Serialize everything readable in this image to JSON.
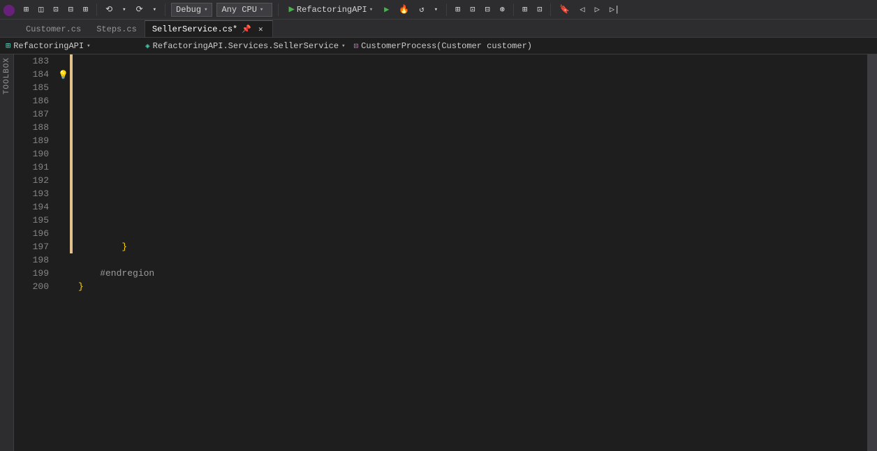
{
  "toolbar": {
    "undo_label": "⟲",
    "redo_label": "⟳",
    "debug_label": "Debug",
    "config_label": "Any CPU",
    "project_label": "RefactoringAPI",
    "run_label": "▶",
    "fire_icon": "🔥",
    "refresh_label": "↺",
    "separator": "|"
  },
  "tabs": [
    {
      "id": "customer",
      "label": "Customer.cs",
      "active": false,
      "modified": false
    },
    {
      "id": "steps",
      "label": "Steps.cs",
      "active": false,
      "modified": false
    },
    {
      "id": "sellerservice",
      "label": "SellerService.cs*",
      "active": true,
      "modified": true
    }
  ],
  "breadcrumb": {
    "left_icon": "⊞",
    "left_text": "RefactoringAPI",
    "right_icon": "◈",
    "right_text": "RefactoringAPI.Services.SellerService",
    "method_icon": "⊡",
    "method_text": "CustomerProcess(Customer customer)"
  },
  "toolbox": {
    "label": "Toolbox"
  },
  "lines": [
    {
      "num": 183,
      "content": "",
      "change": "yellow",
      "gutter": "none"
    },
    {
      "num": 184,
      "content": "",
      "change": "yellow",
      "gutter": "warning"
    },
    {
      "num": 185,
      "content": "",
      "change": "yellow",
      "gutter": "none"
    },
    {
      "num": 186,
      "content": "",
      "change": "yellow",
      "gutter": "none"
    },
    {
      "num": 187,
      "content": "",
      "change": "yellow",
      "gutter": "none"
    },
    {
      "num": 188,
      "content": "",
      "change": "yellow",
      "gutter": "none"
    },
    {
      "num": 189,
      "content": "",
      "change": "yellow",
      "gutter": "none"
    },
    {
      "num": 190,
      "content": "",
      "change": "yellow",
      "gutter": "none"
    },
    {
      "num": 191,
      "content": "",
      "change": "yellow",
      "gutter": "none"
    },
    {
      "num": 192,
      "content": "",
      "change": "yellow",
      "gutter": "none"
    },
    {
      "num": 193,
      "content": "",
      "change": "yellow",
      "gutter": "none"
    },
    {
      "num": 194,
      "content": "",
      "change": "yellow",
      "gutter": "none"
    },
    {
      "num": 195,
      "content": "",
      "change": "yellow",
      "gutter": "none"
    },
    {
      "num": 196,
      "content": "",
      "change": "yellow",
      "gutter": "none"
    },
    {
      "num": 197,
      "content": "        }",
      "change": "yellow",
      "gutter": "none"
    },
    {
      "num": 198,
      "content": "",
      "change": "none",
      "gutter": "none"
    },
    {
      "num": 199,
      "content": "    #endregion",
      "change": "none",
      "gutter": "none"
    },
    {
      "num": 200,
      "content": "}",
      "change": "none",
      "gutter": "none"
    }
  ],
  "colors": {
    "bg": "#1e1e1e",
    "toolbar_bg": "#2d2d30",
    "active_tab_bg": "#1e1e1e",
    "inactive_tab_bg": "#2d2d30",
    "line_num_color": "#858585",
    "change_yellow": "#e2c08d",
    "change_green": "#587c0c",
    "accent_blue": "#007acc",
    "bracket_color": "#ffd700",
    "preprocessor_color": "#9b9b9b"
  }
}
